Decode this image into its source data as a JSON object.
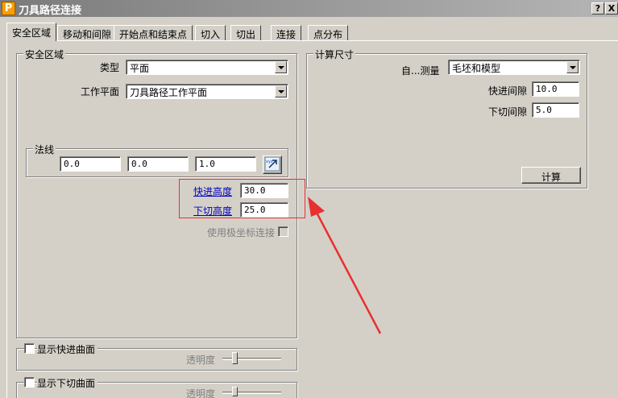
{
  "window": {
    "title": "刀具路径连接",
    "app_icon_letter": "P",
    "help_btn": "?",
    "close_btn": "X"
  },
  "tabs": [
    {
      "label": "安全区域"
    },
    {
      "label": "移动和间隙"
    },
    {
      "label": "开始点和结束点"
    },
    {
      "label": "切入"
    },
    {
      "label": "切出"
    },
    {
      "label": "连接"
    },
    {
      "label": "点分布"
    }
  ],
  "safe_area": {
    "group_label": "安全区域",
    "type_label": "类型",
    "type_value": "平面",
    "workplane_label": "工作平面",
    "workplane_value": "刀具路径工作平面",
    "normal": {
      "group_label": "法线",
      "x": "0.0",
      "y": "0.0",
      "z": "1.0"
    },
    "rapid_height_label": "快进高度",
    "rapid_height_value": "30.0",
    "plunge_height_label": "下切高度",
    "plunge_height_value": "25.0",
    "polar_label": "使用极坐标连接"
  },
  "calc": {
    "group_label": "计算尺寸",
    "auto_label": "自...测量",
    "auto_value": "毛坯和模型",
    "rapid_gap_label": "快进间隙",
    "rapid_gap_value": "10.0",
    "plunge_gap_label": "下切间隙",
    "plunge_gap_value": "5.0",
    "calc_button": "计算"
  },
  "show_rapid": {
    "label": "显示快进曲面",
    "opacity_label": "透明度"
  },
  "show_plunge": {
    "label": "显示下切曲面",
    "opacity_label": "透明度"
  },
  "colors": {
    "annotation_red": "#e83030",
    "link_blue": "#0000c0"
  }
}
